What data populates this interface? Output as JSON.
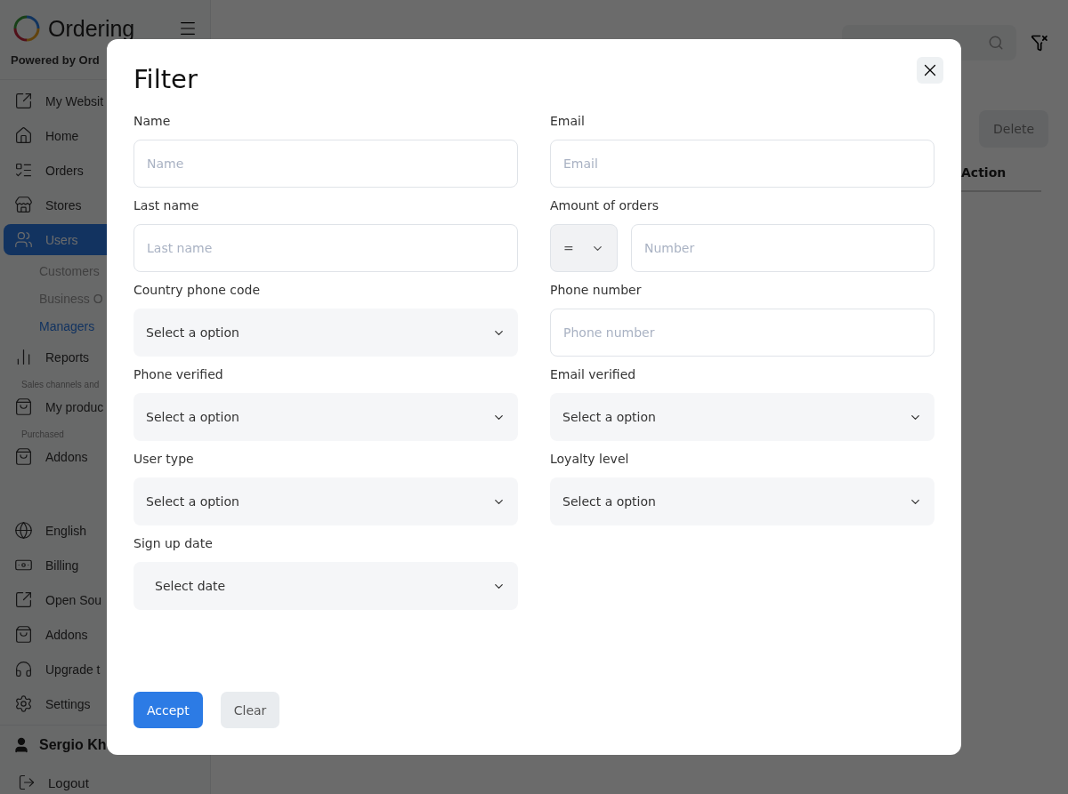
{
  "brand": {
    "name": "Ordering",
    "powered_by": "Powered by Ord"
  },
  "sidebar": {
    "items": [
      {
        "kind": "item",
        "label": "My Websit",
        "selected": false
      },
      {
        "kind": "item",
        "label": "Home",
        "selected": false
      },
      {
        "kind": "item",
        "label": "Orders",
        "selected": false
      },
      {
        "kind": "item",
        "label": "Stores",
        "selected": false
      },
      {
        "kind": "item",
        "label": "Users",
        "selected": true
      },
      {
        "kind": "subitem",
        "label": "Customers",
        "selected": false
      },
      {
        "kind": "subitem",
        "label": "Business O",
        "selected": false
      },
      {
        "kind": "subitem",
        "label": "Managers",
        "selected": true
      },
      {
        "kind": "item",
        "label": "Reports",
        "selected": false
      },
      {
        "kind": "section",
        "label": "Sales channels and"
      },
      {
        "kind": "item",
        "label": "My produc",
        "selected": false
      },
      {
        "kind": "section",
        "label": "Purchased"
      },
      {
        "kind": "item",
        "label": "Addons",
        "selected": false
      },
      {
        "kind": "spacer"
      },
      {
        "kind": "item",
        "label": "English",
        "selected": false
      },
      {
        "kind": "item",
        "label": "Billing",
        "selected": false
      },
      {
        "kind": "item",
        "label": "Open Sou",
        "selected": false
      },
      {
        "kind": "item",
        "label": "Addons",
        "selected": false
      },
      {
        "kind": "item",
        "label": "Upgrade t",
        "selected": false
      },
      {
        "kind": "item",
        "label": "Settings",
        "selected": false
      }
    ],
    "user": "Sergio Kh",
    "logout": "Logout"
  },
  "main": {
    "delete_button": "Delete",
    "column_header": "Action"
  },
  "modal": {
    "title": "Filter",
    "fields": [
      {
        "kind": "text",
        "label": "Name",
        "placeholder": "Name"
      },
      {
        "kind": "text",
        "label": "Email",
        "placeholder": "Email"
      },
      {
        "kind": "text",
        "label": "Last name",
        "placeholder": "Last name"
      },
      {
        "kind": "amount",
        "label": "Amount of orders",
        "operator": "=",
        "placeholder": "Number"
      },
      {
        "kind": "select",
        "label": "Country phone code",
        "value": "Select a option"
      },
      {
        "kind": "text",
        "label": "Phone number",
        "placeholder": "Phone number"
      },
      {
        "kind": "select",
        "label": "Phone verified",
        "value": "Select a option"
      },
      {
        "kind": "select",
        "label": "Email verified",
        "value": "Select a option"
      },
      {
        "kind": "select",
        "label": "User type",
        "value": "Select a option"
      },
      {
        "kind": "select",
        "label": "Loyalty level",
        "value": "Select a option"
      },
      {
        "kind": "date",
        "label": "Sign up date",
        "value": "Select date"
      }
    ],
    "accept_button": "Accept",
    "clear_button": "Clear"
  }
}
